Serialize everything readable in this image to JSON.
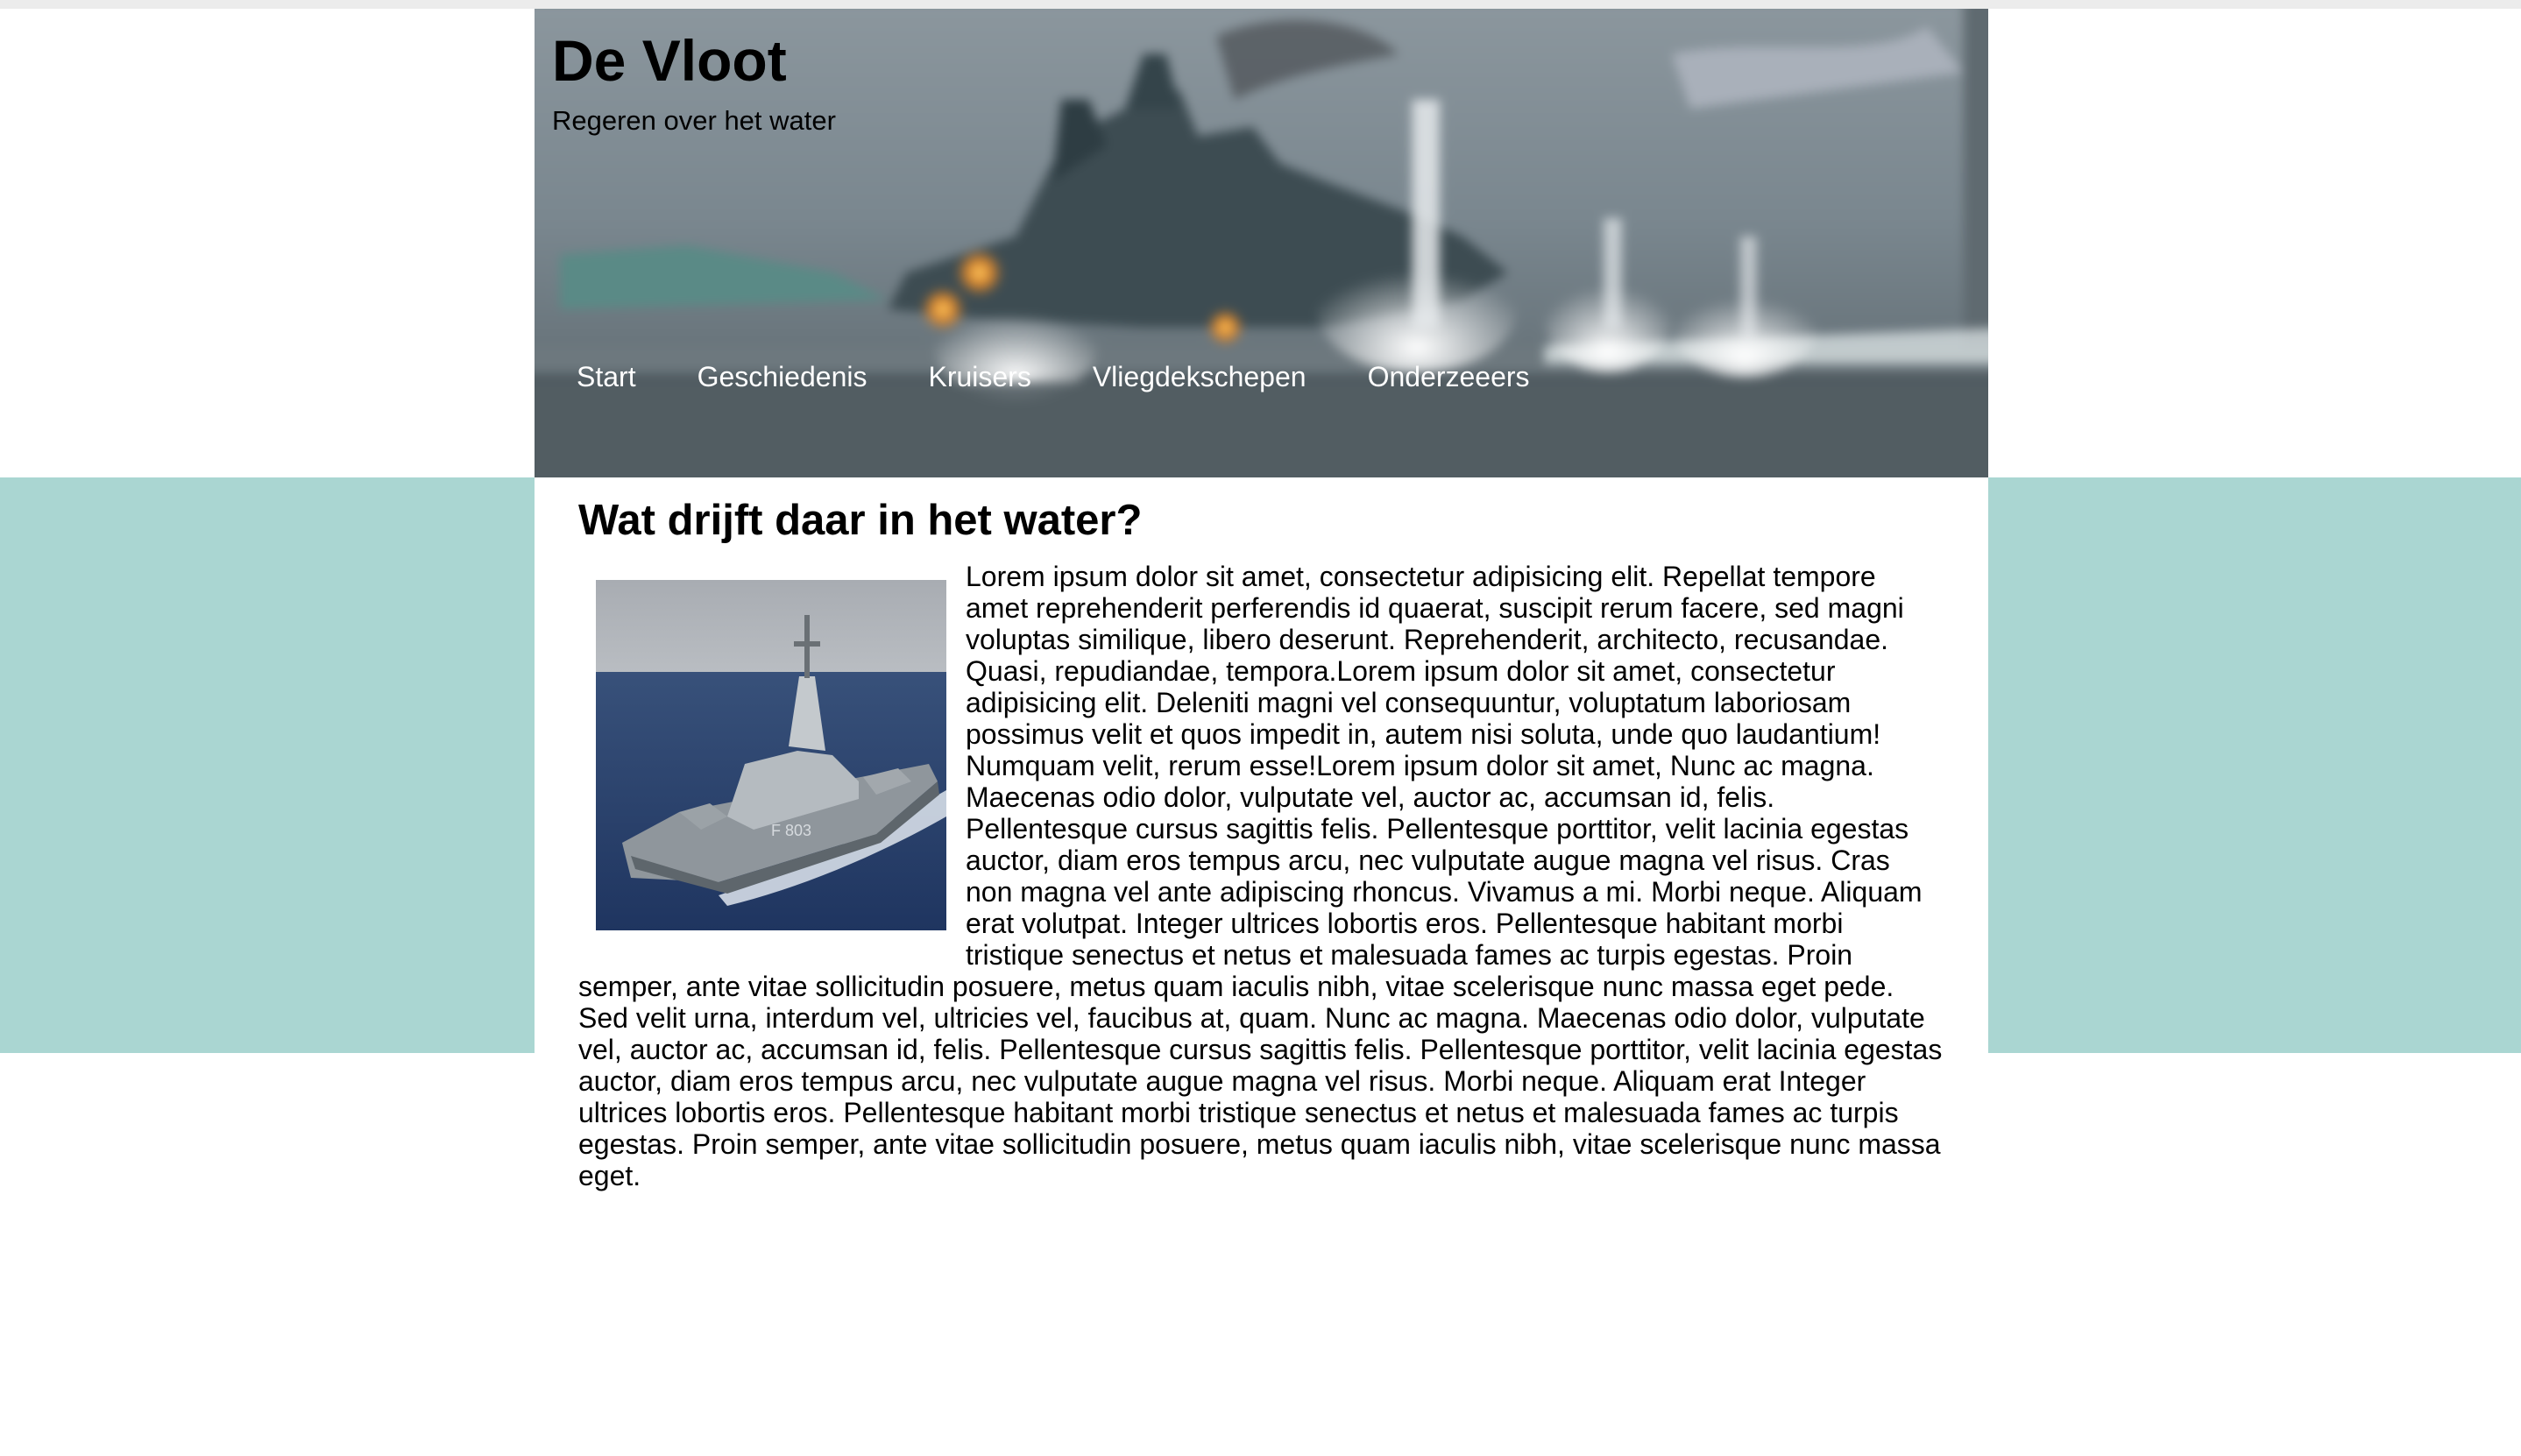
{
  "header": {
    "title": "De Vloot",
    "tagline": "Regeren over het water"
  },
  "nav": {
    "items": [
      {
        "label": "Start"
      },
      {
        "label": "Geschiedenis"
      },
      {
        "label": "Kruisers"
      },
      {
        "label": "Vliegdekschepen"
      },
      {
        "label": "Onderzeeers"
      }
    ]
  },
  "article": {
    "heading": "Wat drijft daar in het water?",
    "body": "Lorem ipsum dolor sit amet, consectetur adipisicing elit. Repellat tempore amet reprehenderit perferendis id quaerat, suscipit rerum facere, sed magni voluptas similique, libero deserunt. Reprehenderit, architecto, recusandae. Quasi, repudiandae, tempora.Lorem ipsum dolor sit amet, consectetur adipisicing elit. Deleniti magni vel consequuntur, voluptatum laboriosam possimus velit et quos impedit in, autem nisi soluta, unde quo laudantium! Numquam velit, rerum esse!Lorem ipsum dolor sit amet, Nunc ac magna. Maecenas odio dolor, vulputate vel, auctor ac, accumsan id, felis. Pellentesque cursus sagittis felis. Pellentesque porttitor, velit lacinia egestas auctor, diam eros tempus arcu, nec vulputate augue magna vel risus. Cras non magna vel ante adipiscing rhoncus. Vivamus a mi. Morbi neque. Aliquam erat volutpat. Integer ultrices lobortis eros. Pellentesque habitant morbi tristique senectus et netus et malesuada fames ac turpis egestas. Proin semper, ante vitae sollicitudin posuere, metus quam iaculis nibh, vitae scelerisque nunc massa eget pede. Sed velit urna, interdum vel, ultricies vel, faucibus at, quam. Nunc ac magna. Maecenas odio dolor, vulputate vel, auctor ac, accumsan id, felis. Pellentesque cursus sagittis felis. Pellentesque porttitor, velit lacinia egestas auctor, diam eros tempus arcu, nec vulputate augue magna vel risus. Morbi neque. Aliquam erat Integer ultrices lobortis eros. Pellentesque habitant morbi tristique senectus et netus et malesuada fames ac turpis egestas. Proin semper, ante vitae sollicitudin posuere, metus quam iaculis nibh, vitae scelerisque nunc massa eget."
  },
  "colors": {
    "band": "#aad6d2",
    "nav_text": "#ffffff",
    "page_background": "#ffffff"
  },
  "images": {
    "banner": "blurred-battleship-photo",
    "article": "frigate-at-sea-photo"
  }
}
